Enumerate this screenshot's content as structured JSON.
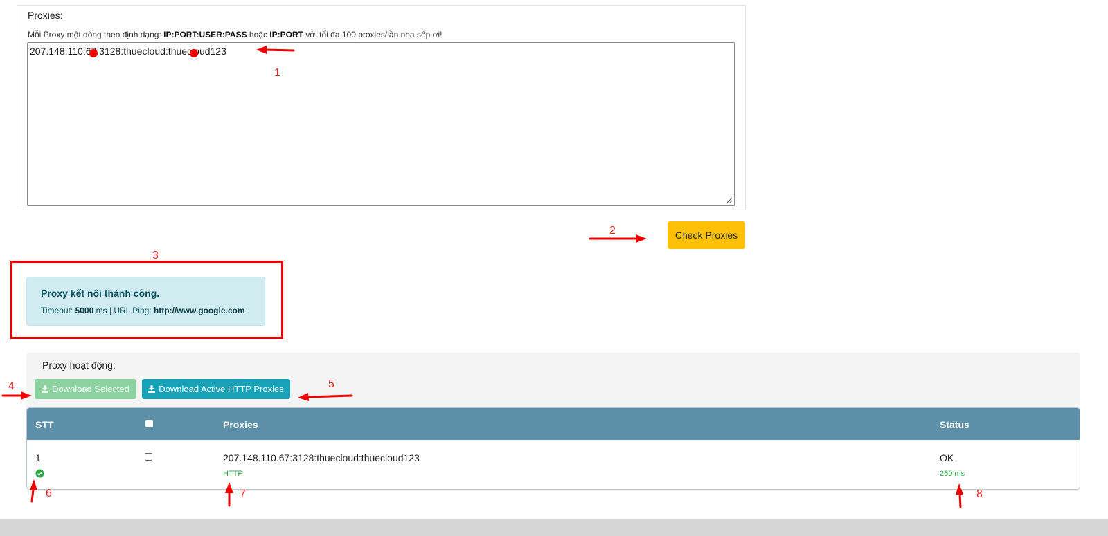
{
  "proxies_input": {
    "label": "Proxies:",
    "hint_prefix": "Mỗi Proxy một dòng theo định dạng: ",
    "hint_format1": "IP:PORT:USER:PASS",
    "hint_mid": " hoặc ",
    "hint_format2": "IP:PORT",
    "hint_suffix": " với tối đa 100 proxies/lần nha sếp ơi!",
    "value": "207.148.110.67:3128:thuecloud:thuecloud123"
  },
  "check_button": {
    "label": "Check Proxies"
  },
  "alert": {
    "title": "Proxy kết nối thành công.",
    "timeout_label": "Timeout: ",
    "timeout_value": "5000",
    "timeout_unit": " ms | URL Ping: ",
    "url_value": "http://www.google.com"
  },
  "active_panel": {
    "title": "Proxy hoạt động:",
    "download_selected_label": "Download Selected",
    "download_active_label": "Download Active HTTP Proxies"
  },
  "table": {
    "headers": {
      "stt": "STT",
      "proxies": "Proxies",
      "status": "Status"
    },
    "rows": [
      {
        "stt": "1",
        "proxy": "207.148.110.67:3128:thuecloud:thuecloud123",
        "type": "HTTP",
        "status": "OK",
        "latency": "260 ms"
      }
    ]
  },
  "annotations": [
    "1",
    "2",
    "3",
    "4",
    "5",
    "6",
    "7",
    "8"
  ],
  "colors": {
    "check_button": "#ffc107",
    "alert_bg": "#d1ecf1",
    "table_header": "#5e8fa8",
    "download_active": "#17a2b8",
    "download_selected": "#8cd1a0",
    "success": "#28a745",
    "annotation": "#ee2222"
  },
  "icons": [
    "download-icon",
    "check-circle-icon",
    "arrow-icon",
    "resize-grip-icon"
  ]
}
